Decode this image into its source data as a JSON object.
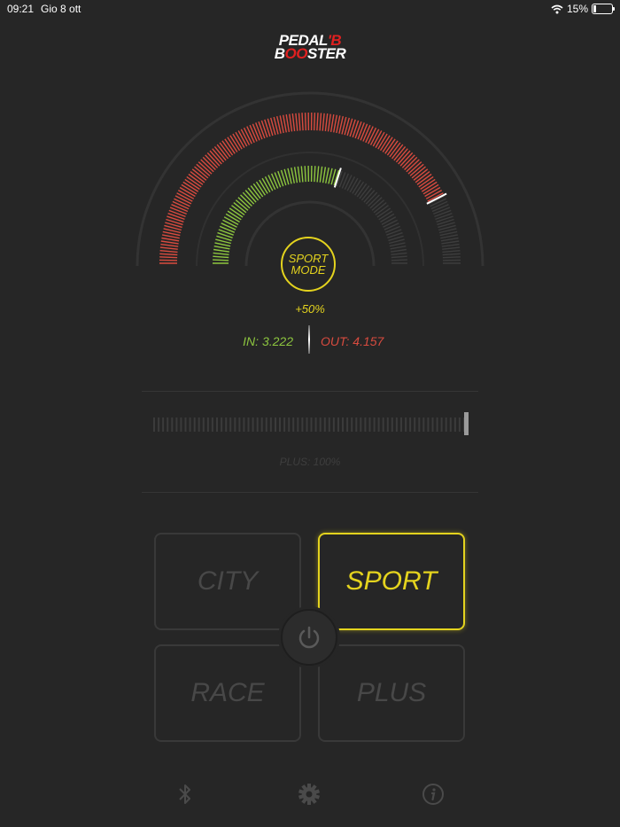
{
  "status": {
    "time": "09:21",
    "date": "Gio 8 ott",
    "battery": "15%",
    "battery_level": 0.15
  },
  "logo": {
    "line1": "PEDAL",
    "line1_accent": "'B",
    "line2a": "B",
    "line2_accent": "OO",
    "line2b": "STER"
  },
  "gauge": {
    "outer_level": 0.85,
    "inner_level": 0.6,
    "outer_color": "#d84b3f",
    "inner_color": "#8dc63f",
    "inactive_color": "#3d3d3d"
  },
  "mode_badge": {
    "line1": "SPORT",
    "line2": "MODE"
  },
  "boost": "+50%",
  "in_value": "IN: 3.222",
  "out_value": "OUT: 4.157",
  "slider": {
    "level": 1.0,
    "label": "PLUS: 100%"
  },
  "modes": {
    "city": "CITY",
    "sport": "SPORT",
    "race": "RACE",
    "plus": "PLUS",
    "active": "sport"
  },
  "icons": {
    "bluetooth": "bluetooth-icon",
    "settings": "gear-icon",
    "info": "info-icon",
    "power": "power-icon",
    "wifi": "wifi-icon"
  },
  "colors": {
    "accent": "#e4d31e",
    "green": "#8dc63f",
    "red": "#d84b3f",
    "background": "#262626"
  }
}
